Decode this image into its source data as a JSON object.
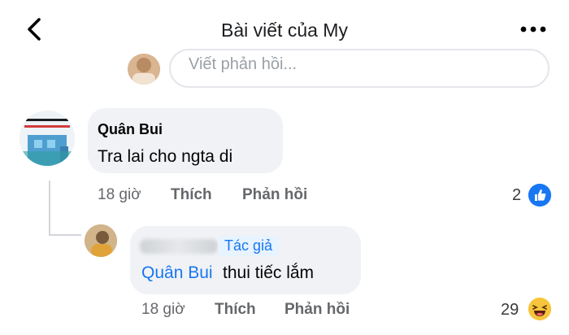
{
  "header": {
    "back_icon": "chevron-left-icon",
    "title": "Bài viết của My",
    "more_icon": "more-dots-icon"
  },
  "reply_box": {
    "placeholder": "Viết phản hồi..."
  },
  "comments": [
    {
      "author": "Quân Bui",
      "text": "Tra lai cho ngta di",
      "time": "18 giờ",
      "like_label": "Thích",
      "reply_label": "Phản hồi",
      "reaction_count": "2",
      "reaction_icon": "like-icon"
    },
    {
      "author_hidden": true,
      "badge": "Tác giả",
      "mention": "Quân Bui",
      "text": "thui tiếc lắm",
      "time": "18 giờ",
      "like_label": "Thích",
      "reply_label": "Phản hồi",
      "reaction_count": "29",
      "reaction_icon": "haha-icon"
    }
  ],
  "colors": {
    "accent": "#1877f2",
    "bubble": "#f0f2f5",
    "meta": "#65676b"
  }
}
